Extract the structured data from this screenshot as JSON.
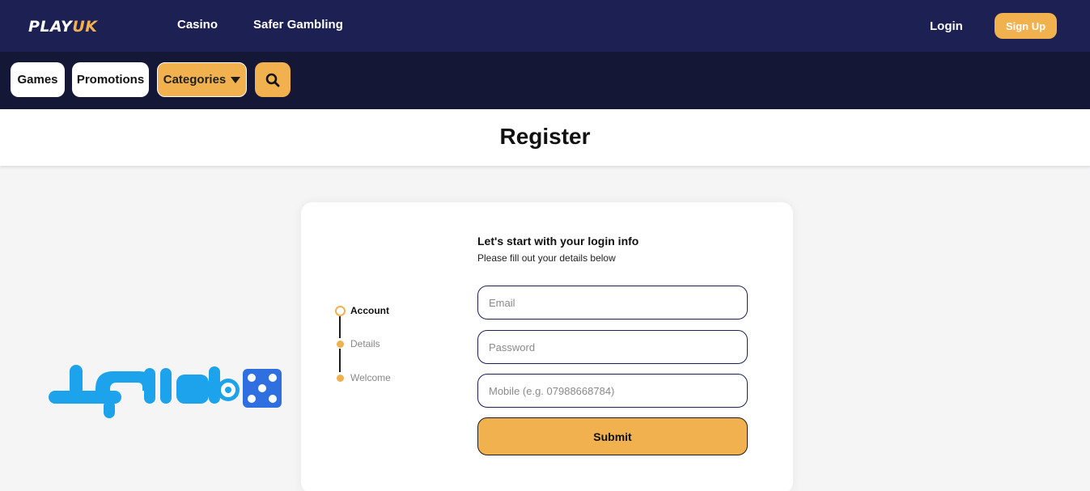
{
  "header": {
    "logo": {
      "play": "PLAY",
      "uk": "UK"
    },
    "nav": [
      "Casino",
      "Safer Gambling"
    ],
    "login_label": "Login",
    "signup_label": "Sign Up"
  },
  "subnav": {
    "games_label": "Games",
    "promotions_label": "Promotions",
    "categories_label": "Categories",
    "search_icon": "search-icon"
  },
  "page": {
    "title": "Register"
  },
  "register": {
    "steps": [
      {
        "label": "Account",
        "state": "active"
      },
      {
        "label": "Details",
        "state": "pending"
      },
      {
        "label": "Welcome",
        "state": "pending"
      }
    ],
    "heading": "Let's start with your login info",
    "subheading": "Please fill out your details below",
    "email_placeholder": "Email",
    "password_placeholder": "Password",
    "mobile_placeholder": "Mobile (e.g. 07988668784)",
    "submit_label": "Submit"
  },
  "colors": {
    "header_bg": "#1c2052",
    "subnav_bg": "#141735",
    "accent": "#f0b14e"
  }
}
